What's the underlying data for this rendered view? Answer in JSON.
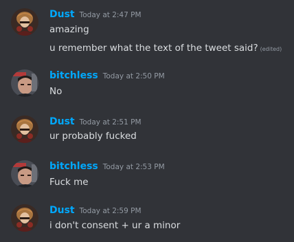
{
  "colors": {
    "background": "#313338",
    "username": "#00a8fc",
    "timestamp": "#949ba4",
    "text": "#dbdee1"
  },
  "messages": [
    {
      "author": "Dust",
      "avatar": "dust-avatar",
      "time": "Today at 2:47 PM",
      "lines": [
        "amazing",
        "u remember what the text of the tweet said?"
      ],
      "edited_label": "(edited)"
    },
    {
      "author": "bitchless",
      "avatar": "bitchless-avatar",
      "time": "Today at 2:50 PM",
      "lines": [
        "No"
      ]
    },
    {
      "author": "Dust",
      "avatar": "dust-avatar",
      "time": "Today at 2:51 PM",
      "lines": [
        "ur probably fucked"
      ]
    },
    {
      "author": "bitchless",
      "avatar": "bitchless-avatar",
      "time": "Today at 2:53 PM",
      "lines": [
        "Fuck me"
      ]
    },
    {
      "author": "Dust",
      "avatar": "dust-avatar",
      "time": "Today at 2:59 PM",
      "lines": [
        "i don't consent + ur a minor"
      ]
    }
  ]
}
